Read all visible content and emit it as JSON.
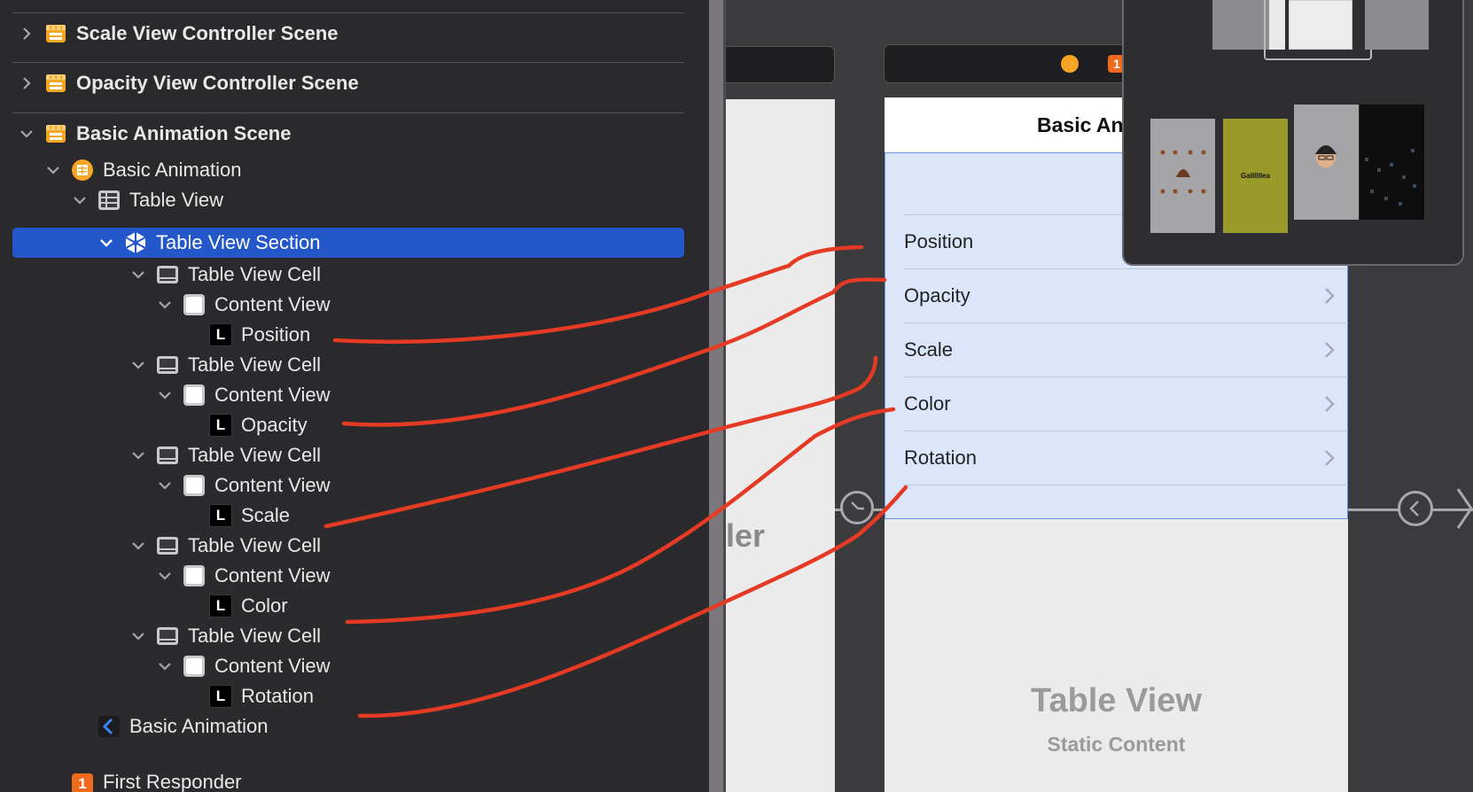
{
  "outline": {
    "rows": [
      {
        "label": "Scale View Controller Scene",
        "icon": "scene-icon"
      },
      {
        "label": "Opacity View Controller Scene",
        "icon": "scene-icon"
      },
      {
        "label": "Basic Animation Scene",
        "icon": "scene-icon"
      },
      {
        "label": "Basic Animation",
        "icon": "view-controller-icon"
      },
      {
        "label": "Table View",
        "icon": "table-view-icon"
      },
      {
        "label": "Table View Section",
        "icon": "table-section-icon"
      },
      {
        "label": "Table View Cell",
        "icon": "table-cell-icon"
      },
      {
        "label": "Content View",
        "icon": "content-view-icon"
      },
      {
        "label": "Position",
        "icon": "label-icon"
      },
      {
        "label": "Table View Cell",
        "icon": "table-cell-icon"
      },
      {
        "label": "Content View",
        "icon": "content-view-icon"
      },
      {
        "label": "Opacity",
        "icon": "label-icon"
      },
      {
        "label": "Table View Cell",
        "icon": "table-cell-icon"
      },
      {
        "label": "Content View",
        "icon": "content-view-icon"
      },
      {
        "label": "Scale",
        "icon": "label-icon"
      },
      {
        "label": "Table View Cell",
        "icon": "table-cell-icon"
      },
      {
        "label": "Content View",
        "icon": "content-view-icon"
      },
      {
        "label": "Color",
        "icon": "label-icon"
      },
      {
        "label": "Table View Cell",
        "icon": "table-cell-icon"
      },
      {
        "label": "Content View",
        "icon": "content-view-icon"
      },
      {
        "label": "Rotation",
        "icon": "label-icon"
      },
      {
        "label": "Basic Animation",
        "icon": "navigation-item-icon"
      },
      {
        "label": "First Responder",
        "icon": "first-responder-icon"
      }
    ],
    "label_badge": "L",
    "first_responder_badge": "1",
    "selected_color": "#2457c9"
  },
  "canvas": {
    "prev_scene_text": "ler",
    "nav_title": "Basic Ani",
    "cells": [
      "Position",
      "Opacity",
      "Scale",
      "Color",
      "Rotation"
    ],
    "placeholder_title": "Table View",
    "placeholder_subtitle": "Static Content",
    "minimap_thumb_text": "Gallllllea",
    "dock_badge": "1"
  },
  "colors": {
    "table_fill": "#dbe6fb",
    "table_border": "#6a93e8",
    "annotation": "#e53a24",
    "scene_icon": "#f5a623"
  }
}
